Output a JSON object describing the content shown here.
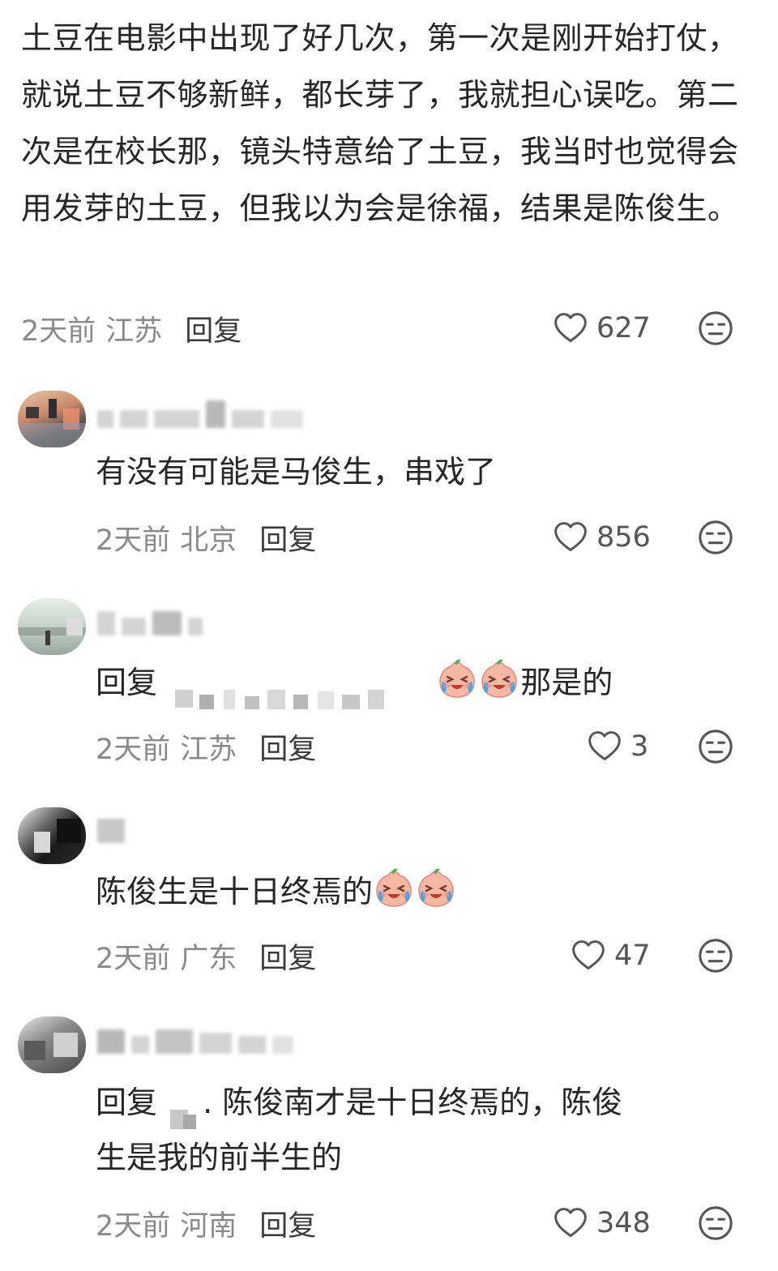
{
  "main": {
    "text": "土豆在电影中出现了好几次，第一次是刚开始打仗，就说土豆不够新鲜，都长芽了，我就担心误吃。第二次是在校长那，镜头特意给了土豆，我当时也觉得会用发芽的土豆，但我以为会是徐福，结果是陈俊生。",
    "time": "2天前",
    "location": "江苏",
    "reply_label": "回复",
    "likes": "627",
    "like_icon": "heart-outline-icon",
    "face_icon": "neutral-face-icon"
  },
  "replies": [
    {
      "text": "有没有可能是马俊生，串戏了",
      "time": "2天前",
      "location": "北京",
      "reply_label": "回复",
      "likes": "856"
    },
    {
      "prefix": "回复",
      "text": "那是的",
      "emoji": "crying-laughing-peach-emoji",
      "time": "2天前",
      "location": "江苏",
      "reply_label": "回复",
      "likes": "3"
    },
    {
      "text": "陈俊生是十日终焉的",
      "emoji": "crying-laughing-peach-emoji",
      "time": "2天前",
      "location": "广东",
      "reply_label": "回复",
      "likes": "47"
    },
    {
      "prefix": "回复",
      "text_line1": ". 陈俊南才是十日终焉的，陈俊",
      "text_line2": "生是我的前半生的",
      "time": "2天前",
      "location": "河南",
      "reply_label": "回复",
      "likes": "348"
    }
  ],
  "colors": {
    "text": "#262626",
    "meta": "#8a8a8a",
    "icon": "#555555"
  }
}
